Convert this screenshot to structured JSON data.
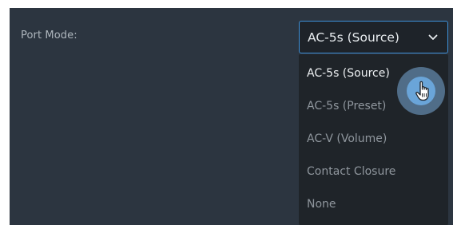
{
  "port_mode": {
    "label": "Port Mode:",
    "selected_value": "AC-5s (Source)",
    "options": [
      {
        "label": "AC-5s (Source)",
        "selected": true
      },
      {
        "label": "AC-5s (Preset)",
        "selected": false
      },
      {
        "label": "AC-V (Volume)",
        "selected": false
      },
      {
        "label": "Contact Closure",
        "selected": false
      },
      {
        "label": "None",
        "selected": false
      }
    ]
  },
  "icons": {
    "dropdown": "chevron-down-icon",
    "cursor": "hand-pointer-cursor-icon"
  },
  "colors": {
    "panel_background": "#2c3540",
    "select_border_accent": "#3d8fd6",
    "dropdown_background": "#1f2429",
    "cursor_highlight": "#6aa5d9"
  }
}
